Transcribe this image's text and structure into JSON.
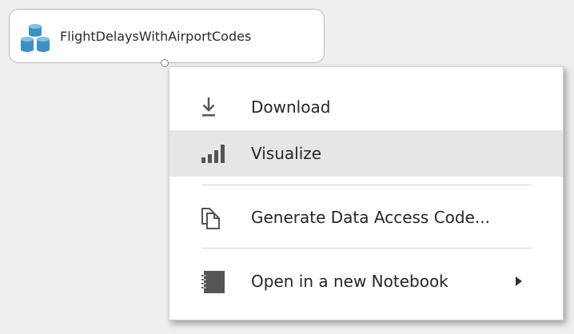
{
  "module": {
    "label": "FlightDelaysWithAirportCodes",
    "icon": "dataset-icon",
    "icon_color": "#3f8fc3"
  },
  "context_menu": {
    "items": [
      {
        "label": "Download",
        "icon": "download-icon"
      },
      {
        "label": "Visualize",
        "icon": "bar-chart-icon",
        "highlighted": true
      },
      {
        "label": "Generate Data Access Code...",
        "icon": "copy-icon"
      },
      {
        "label": "Open in a new Notebook",
        "icon": "notebook-icon",
        "has_submenu": true
      }
    ],
    "highlight_color": "#e6e6e6",
    "icon_color": "#555555"
  }
}
